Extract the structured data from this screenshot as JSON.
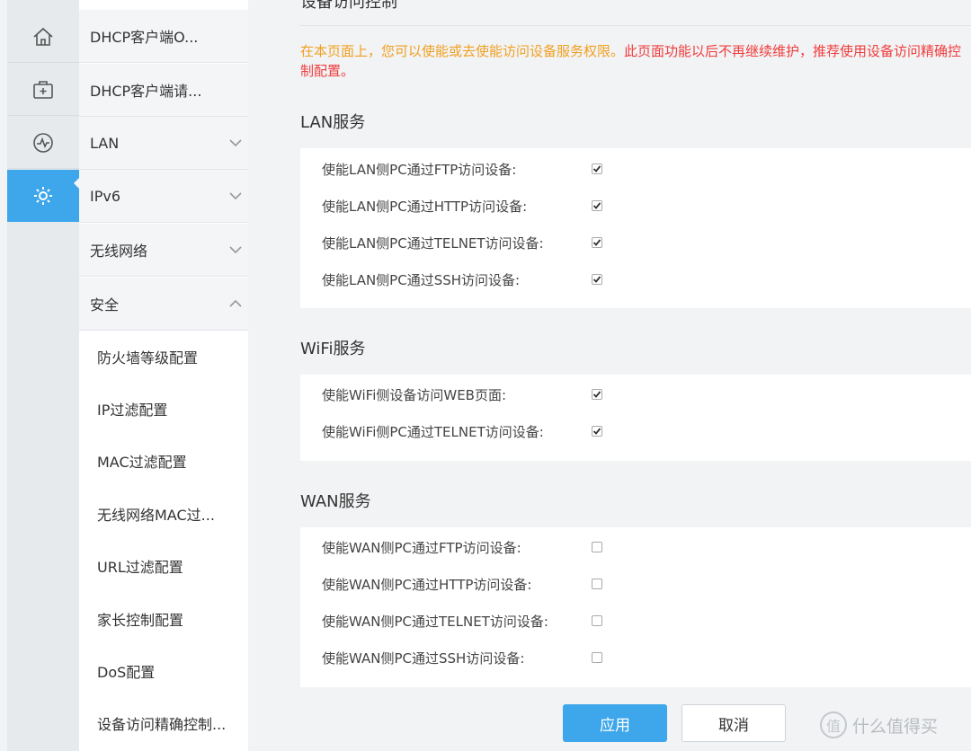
{
  "rail": {
    "items": [
      {
        "icon": "home-icon"
      },
      {
        "icon": "medical-box-icon"
      },
      {
        "icon": "monitor-pulse-icon"
      },
      {
        "icon": "gear-icon",
        "active": true
      }
    ],
    "accent": "#3ea6ea"
  },
  "menu": {
    "items": [
      {
        "label": "DHCP客户端O..."
      },
      {
        "label": "DHCP客户端请..."
      },
      {
        "label": "LAN",
        "icon": "chevron-down-icon"
      },
      {
        "label": "IPv6",
        "icon": "chevron-down-icon"
      },
      {
        "label": "无线网络",
        "icon": "chevron-down-icon"
      },
      {
        "label": "安全",
        "icon": "chevron-up-icon"
      }
    ],
    "subitems": [
      {
        "label": "防火墙等级配置"
      },
      {
        "label": "IP过滤配置"
      },
      {
        "label": "MAC过滤配置"
      },
      {
        "label": "无线网络MAC过..."
      },
      {
        "label": "URL过滤配置"
      },
      {
        "label": "家长控制配置"
      },
      {
        "label": "DoS配置"
      },
      {
        "label": "设备访问精确控制..."
      }
    ]
  },
  "main": {
    "title": "设备访问控制",
    "notice_orange": "在本页面上，您可以使能或去使能访问设备服务权限。",
    "notice_red": "此页面功能以后不再继续维护，推荐使用设备访问精确控制配置。",
    "sections": [
      {
        "title": "LAN服务",
        "rows": [
          {
            "label": "使能LAN侧PC通过FTP访问设备:",
            "checked": true
          },
          {
            "label": "使能LAN侧PC通过HTTP访问设备:",
            "checked": true
          },
          {
            "label": "使能LAN侧PC通过TELNET访问设备:",
            "checked": true
          },
          {
            "label": "使能LAN侧PC通过SSH访问设备:",
            "checked": true
          }
        ]
      },
      {
        "title": "WiFi服务",
        "rows": [
          {
            "label": "使能WiFi侧设备访问WEB页面:",
            "checked": true
          },
          {
            "label": "使能WiFi侧PC通过TELNET访问设备:",
            "checked": true
          }
        ]
      },
      {
        "title": "WAN服务",
        "rows": [
          {
            "label": "使能WAN侧PC通过FTP访问设备:",
            "checked": false
          },
          {
            "label": "使能WAN侧PC通过HTTP访问设备:",
            "checked": false
          },
          {
            "label": "使能WAN侧PC通过TELNET访问设备:",
            "checked": false
          },
          {
            "label": "使能WAN侧PC通过SSH访问设备:",
            "checked": false
          }
        ]
      }
    ],
    "apply_label": "应用",
    "cancel_label": "取消"
  },
  "watermark": {
    "badge": "值",
    "text": "什么值得买"
  }
}
